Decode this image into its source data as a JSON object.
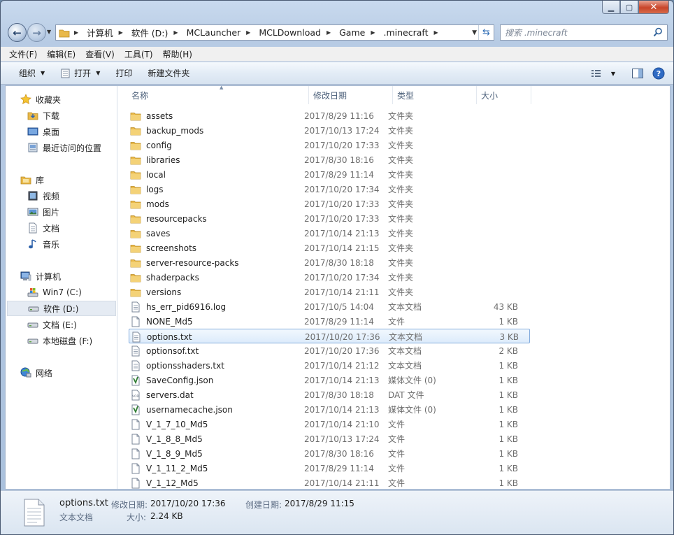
{
  "window": {
    "caption": {
      "minimize_icon": "minimize-icon",
      "maximize_icon": "maximize-icon",
      "close_icon": "close-icon"
    }
  },
  "address": {
    "crumbs": [
      "计算机",
      "软件 (D:)",
      "MCLauncher",
      "MCLDownload",
      "Game",
      ".minecraft"
    ]
  },
  "search": {
    "placeholder": "搜索 .minecraft"
  },
  "menu": [
    "文件(F)",
    "编辑(E)",
    "查看(V)",
    "工具(T)",
    "帮助(H)"
  ],
  "toolbar": {
    "organize": "组织",
    "open": "打开",
    "print": "打印",
    "new_folder": "新建文件夹"
  },
  "nav": {
    "favorites": "收藏夹",
    "downloads": "下载",
    "desktop": "桌面",
    "recent": "最近访问的位置",
    "libraries": "库",
    "videos": "视频",
    "pictures": "图片",
    "documents": "文档",
    "music": "音乐",
    "computer": "计算机",
    "drive_c": "Win7 (C:)",
    "drive_d": "软件 (D:)",
    "drive_e": "文档 (E:)",
    "drive_f": "本地磁盘 (F:)",
    "network": "网络"
  },
  "columns": {
    "name": "名称",
    "date": "修改日期",
    "type": "类型",
    "size": "大小"
  },
  "files": [
    {
      "name": "assets",
      "date": "2017/8/29 11:16",
      "type": "文件夹",
      "size": "",
      "icon": "folder"
    },
    {
      "name": "backup_mods",
      "date": "2017/10/13 17:24",
      "type": "文件夹",
      "size": "",
      "icon": "folder"
    },
    {
      "name": "config",
      "date": "2017/10/20 17:33",
      "type": "文件夹",
      "size": "",
      "icon": "folder"
    },
    {
      "name": "libraries",
      "date": "2017/8/30 18:16",
      "type": "文件夹",
      "size": "",
      "icon": "folder"
    },
    {
      "name": "local",
      "date": "2017/8/29 11:14",
      "type": "文件夹",
      "size": "",
      "icon": "folder"
    },
    {
      "name": "logs",
      "date": "2017/10/20 17:34",
      "type": "文件夹",
      "size": "",
      "icon": "folder"
    },
    {
      "name": "mods",
      "date": "2017/10/20 17:33",
      "type": "文件夹",
      "size": "",
      "icon": "folder"
    },
    {
      "name": "resourcepacks",
      "date": "2017/10/20 17:33",
      "type": "文件夹",
      "size": "",
      "icon": "folder"
    },
    {
      "name": "saves",
      "date": "2017/10/14 21:13",
      "type": "文件夹",
      "size": "",
      "icon": "folder"
    },
    {
      "name": "screenshots",
      "date": "2017/10/14 21:15",
      "type": "文件夹",
      "size": "",
      "icon": "folder"
    },
    {
      "name": "server-resource-packs",
      "date": "2017/8/30 18:18",
      "type": "文件夹",
      "size": "",
      "icon": "folder"
    },
    {
      "name": "shaderpacks",
      "date": "2017/10/20 17:34",
      "type": "文件夹",
      "size": "",
      "icon": "folder"
    },
    {
      "name": "versions",
      "date": "2017/10/14 21:11",
      "type": "文件夹",
      "size": "",
      "icon": "folder"
    },
    {
      "name": "hs_err_pid6916.log",
      "date": "2017/10/5 14:04",
      "type": "文本文档",
      "size": "43 KB",
      "icon": "text"
    },
    {
      "name": "NONE_Md5",
      "date": "2017/8/29 11:14",
      "type": "文件",
      "size": "1 KB",
      "icon": "blank"
    },
    {
      "name": "options.txt",
      "date": "2017/10/20 17:36",
      "type": "文本文档",
      "size": "3 KB",
      "icon": "text",
      "selected": true
    },
    {
      "name": "optionsof.txt",
      "date": "2017/10/20 17:36",
      "type": "文本文档",
      "size": "2 KB",
      "icon": "text"
    },
    {
      "name": "optionsshaders.txt",
      "date": "2017/10/14 21:12",
      "type": "文本文档",
      "size": "1 KB",
      "icon": "text"
    },
    {
      "name": "SaveConfig.json",
      "date": "2017/10/14 21:13",
      "type": "媒体文件 (0)",
      "size": "1 KB",
      "icon": "json"
    },
    {
      "name": "servers.dat",
      "date": "2017/8/30 18:18",
      "type": "DAT 文件",
      "size": "1 KB",
      "icon": "dat"
    },
    {
      "name": "usernamecache.json",
      "date": "2017/10/14 21:13",
      "type": "媒体文件 (0)",
      "size": "1 KB",
      "icon": "json"
    },
    {
      "name": "V_1_7_10_Md5",
      "date": "2017/10/14 21:10",
      "type": "文件",
      "size": "1 KB",
      "icon": "blank"
    },
    {
      "name": "V_1_8_8_Md5",
      "date": "2017/10/13 17:24",
      "type": "文件",
      "size": "1 KB",
      "icon": "blank"
    },
    {
      "name": "V_1_8_9_Md5",
      "date": "2017/8/30 18:16",
      "type": "文件",
      "size": "1 KB",
      "icon": "blank"
    },
    {
      "name": "V_1_11_2_Md5",
      "date": "2017/8/29 11:14",
      "type": "文件",
      "size": "1 KB",
      "icon": "blank"
    },
    {
      "name": "V_1_12_Md5",
      "date": "2017/10/14 21:11",
      "type": "文件",
      "size": "1 KB",
      "icon": "blank"
    }
  ],
  "details": {
    "filename": "options.txt",
    "filetype": "文本文档",
    "modified_label": "修改日期:",
    "modified_value": "2017/10/20 17:36",
    "created_label": "创建日期:",
    "created_value": "2017/8/29 11:15",
    "size_label": "大小:",
    "size_value": "2.24 KB"
  },
  "colors": {
    "selection_border": "#84acdd",
    "selection_fill": "#dcebfb",
    "folder": "#f2c94c"
  }
}
